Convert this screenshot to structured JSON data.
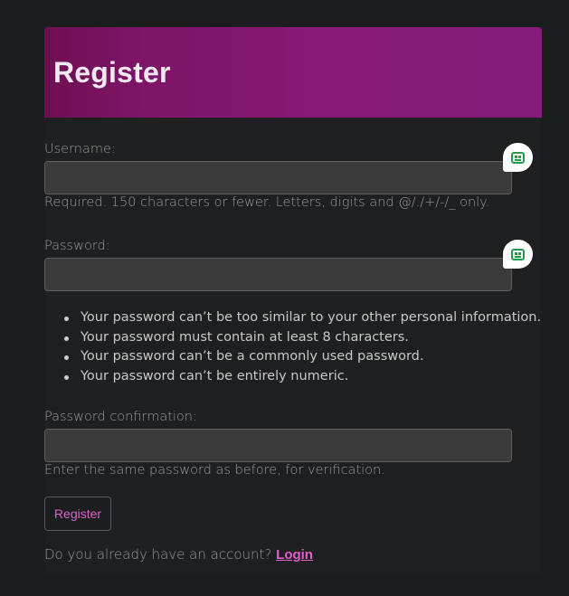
{
  "header": {
    "title": "Register"
  },
  "form": {
    "username": {
      "label": "Username:",
      "value": "",
      "help": "Required. 150 characters or fewer. Letters, digits and @/./+/-/_ only."
    },
    "password": {
      "label": "Password:",
      "value": "",
      "rules": [
        "Your password can’t be too similar to your other personal information.",
        "Your password must contain at least 8 characters.",
        "Your password can’t be a commonly used password.",
        "Your password can’t be entirely numeric."
      ]
    },
    "password_confirmation": {
      "label": "Password confirmation:",
      "value": "",
      "help": "Enter the same password as before, for verification."
    },
    "submit_label": "Register"
  },
  "footer": {
    "prompt": "Do you already have an account?",
    "login_label": "Login"
  },
  "icons": {
    "password_manager": "password-manager-bot-icon"
  },
  "colors": {
    "header_gradient_start": "#6e0f52",
    "header_gradient_end": "#851c7a",
    "accent": "#e35fd0",
    "background": "#1b1c1d",
    "input_bg": "#3a3a3a",
    "badge_green": "#1f9d4a"
  }
}
